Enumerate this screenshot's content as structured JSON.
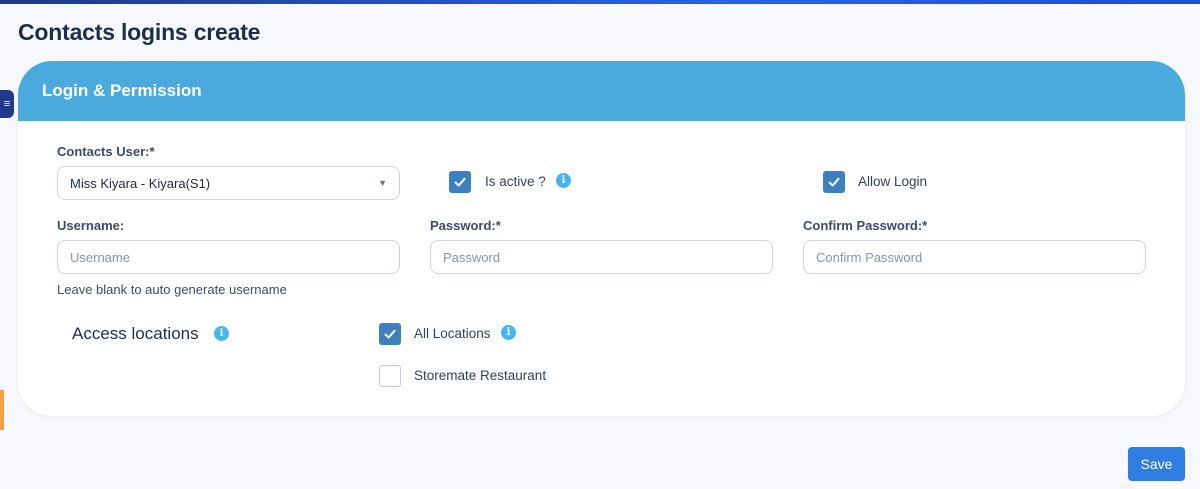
{
  "page": {
    "title": "Contacts logins create"
  },
  "card": {
    "title": "Login & Permission"
  },
  "form": {
    "contacts_user": {
      "label": "Contacts User:*",
      "selected": "Miss Kiyara - Kiyara(S1)"
    },
    "is_active": {
      "label": "Is active ?",
      "checked": true
    },
    "allow_login": {
      "label": "Allow Login",
      "checked": true
    },
    "username": {
      "label": "Username:",
      "placeholder": "Username",
      "help": "Leave blank to auto generate username"
    },
    "password": {
      "label": "Password:*",
      "placeholder": "Password"
    },
    "confirm_password": {
      "label": "Confirm Password:*",
      "placeholder": "Confirm Password"
    }
  },
  "access": {
    "title": "Access locations",
    "locations": [
      {
        "label": "All Locations",
        "checked": true
      },
      {
        "label": "Storemate Restaurant",
        "checked": false
      }
    ]
  },
  "actions": {
    "save_label": "Save"
  },
  "colors": {
    "header": "#4aa9dd",
    "checkbox": "#3d80bf",
    "primary": "#2f7de1",
    "info": "#47b5ee"
  }
}
